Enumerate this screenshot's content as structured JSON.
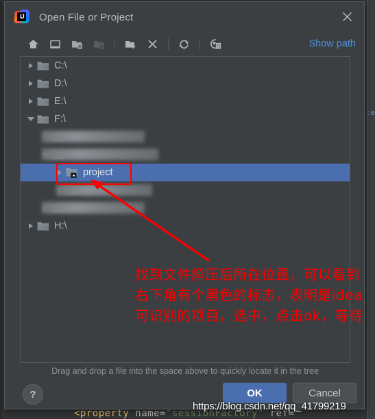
{
  "window": {
    "title": "Open File or Project",
    "app_icon": "intellij-idea-logo",
    "close_icon": "close-icon"
  },
  "toolbar": {
    "items": [
      {
        "name": "home-icon",
        "tooltip": "Home",
        "disabled": false
      },
      {
        "name": "desktop-icon",
        "tooltip": "Desktop",
        "disabled": false
      },
      {
        "name": "expand-folder-icon",
        "tooltip": "Expand All",
        "disabled": false
      },
      {
        "name": "collapse-folder-icon",
        "tooltip": "Collapse All",
        "disabled": true
      },
      {
        "name": "new-folder-icon",
        "tooltip": "New Folder",
        "disabled": false
      },
      {
        "name": "delete-icon",
        "tooltip": "Delete",
        "disabled": false
      },
      {
        "name": "refresh-icon",
        "tooltip": "Refresh",
        "disabled": false
      },
      {
        "name": "show-hidden-files-icon",
        "tooltip": "Show Hidden Files",
        "disabled": false
      }
    ],
    "show_path_label": "Show path"
  },
  "tree": {
    "rows": [
      {
        "label": "C:\\",
        "indent": 0,
        "twisty": "closed",
        "icon": "drive-folder-icon",
        "selected": false,
        "censored": false
      },
      {
        "label": "D:\\",
        "indent": 0,
        "twisty": "closed",
        "icon": "drive-folder-icon",
        "selected": false,
        "censored": false
      },
      {
        "label": "E:\\",
        "indent": 0,
        "twisty": "closed",
        "icon": "drive-folder-icon",
        "selected": false,
        "censored": false
      },
      {
        "label": "F:\\",
        "indent": 0,
        "twisty": "open",
        "icon": "drive-folder-icon",
        "selected": false,
        "censored": false
      },
      {
        "label": "",
        "indent": 1,
        "twisty": "none",
        "icon": "folder-icon",
        "selected": false,
        "censored": true
      },
      {
        "label": "",
        "indent": 1,
        "twisty": "open",
        "icon": "folder-icon",
        "selected": false,
        "censored": true
      },
      {
        "label": "project",
        "indent": 2,
        "twisty": "closed",
        "icon": "module-folder-icon",
        "selected": true,
        "censored": false
      },
      {
        "label": "",
        "indent": 2,
        "twisty": "closed",
        "icon": "folder-icon",
        "selected": false,
        "censored": true
      },
      {
        "label": "",
        "indent": 1,
        "twisty": "closed",
        "icon": "folder-icon",
        "selected": false,
        "censored": true
      },
      {
        "label": "H:\\",
        "indent": 0,
        "twisty": "closed",
        "icon": "drive-folder-icon",
        "selected": false,
        "censored": false
      }
    ]
  },
  "annotation": {
    "text": "找到文件解压后所在位置，可以看到右下角有个黑色的标志，表明是idea可识别的项目，选中，点击ok，等待",
    "color": "#fb0000",
    "highlight_box_color": "#ff0000",
    "arrow": "red-arrow-pointing-to-project-folder"
  },
  "footer": {
    "drag_hint": "Drag and drop a file into the space above to quickly locate it in the tree",
    "help_label": "?",
    "ok_label": "OK",
    "cancel_label": "Cancel"
  },
  "watermark": {
    "text": "https://blog.csdn.net/qq_41799219"
  },
  "background": {
    "code_tag": "<property",
    "code_attr": " name=",
    "code_str": "\"sessionFactory\"",
    "code_attr2": " ref=",
    "code_str2": "\"",
    "right_text": ":e"
  },
  "colors": {
    "dialog_bg": "#3c3f41",
    "selection_blue": "#4b6eaf",
    "link_blue": "#4b8fdc",
    "annotation_red": "#fb0000",
    "editor_bg": "#313335"
  }
}
